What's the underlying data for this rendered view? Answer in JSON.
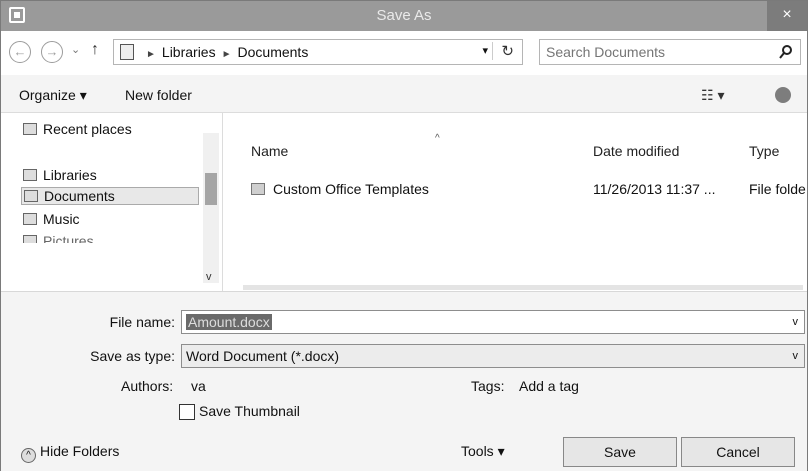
{
  "window": {
    "title": "Save As",
    "close_label": "×"
  },
  "nav": {
    "back": "←",
    "forward": "→",
    "recent": "⌄",
    "up": "↑",
    "breadcrumbs": [
      "Libraries",
      "Documents"
    ],
    "address_dropdown": "▾",
    "refresh": "↻"
  },
  "search": {
    "placeholder": "Search Documents"
  },
  "toolbar": {
    "organize_label": "Organize ▾",
    "new_folder_label": "New folder",
    "views_label": "☷ ▾"
  },
  "sidebar": {
    "items": [
      {
        "label": "Recent places"
      },
      {
        "label": "Libraries"
      },
      {
        "label": "Documents"
      },
      {
        "label": "Music"
      },
      {
        "label": "Pictures"
      }
    ],
    "scroll_up": "^",
    "scroll_down": "v"
  },
  "filelist": {
    "columns": [
      "Name",
      "Date modified",
      "Type"
    ],
    "sort_indicator": "^",
    "rows": [
      {
        "name": "Custom Office Templates",
        "date": "11/26/2013 11:37 ...",
        "type": "File folde"
      }
    ]
  },
  "form": {
    "file_name_label": "File name:",
    "file_name_value": "Amount.docx",
    "save_type_label": "Save as type:",
    "save_type_value": "Word Document (*.docx)",
    "dropdown_arrow": "v",
    "authors_label": "Authors:",
    "authors_value": "va",
    "tags_label": "Tags:",
    "tags_value": "Add a tag",
    "thumbnail_label": "Save Thumbnail"
  },
  "footer": {
    "hide_folders_label": "Hide Folders",
    "tools_label": "Tools  ▾",
    "save_label": "Save",
    "cancel_label": "Cancel"
  }
}
